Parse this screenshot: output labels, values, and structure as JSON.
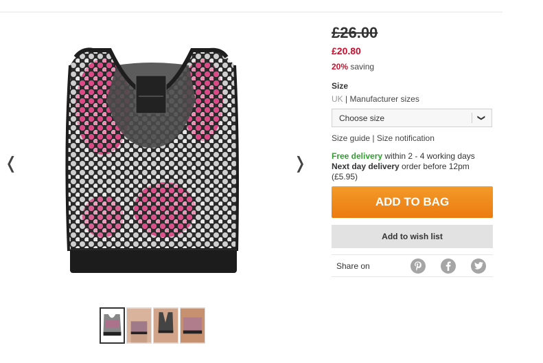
{
  "gallery": {
    "prev_arrow": "❬",
    "next_arrow": "❭",
    "thumbnail_count": 4,
    "active_thumbnail": 1
  },
  "pricing": {
    "was_price": "£26.00",
    "now_price": "£20.80",
    "saving_pct": "20%",
    "saving_label": " saving"
  },
  "size": {
    "heading": "Size",
    "unit_uk": "UK",
    "unit_separator": " | ",
    "unit_manufacturer": "Manufacturer sizes",
    "select_placeholder": "Choose size",
    "chevron": "❯",
    "guide_link": "Size guide",
    "link_separator": " | ",
    "notification_link": "Size notification"
  },
  "delivery": {
    "free_label": "Free delivery",
    "free_detail": " within 2 - 4 working days",
    "next_day_label": "Next day delivery",
    "next_day_detail": " order before 12pm (£5.95)"
  },
  "actions": {
    "add_to_bag": "ADD TO BAG",
    "add_to_wishlist": "Add to wish list"
  },
  "share": {
    "label": "Share on",
    "icons": [
      "pinterest-icon",
      "facebook-icon",
      "twitter-icon"
    ]
  },
  "colors": {
    "sale_red": "#c8102e",
    "bag_orange": "#ef8419",
    "free_green": "#2e9e2e",
    "icon_grey": "#a5a5a5"
  }
}
